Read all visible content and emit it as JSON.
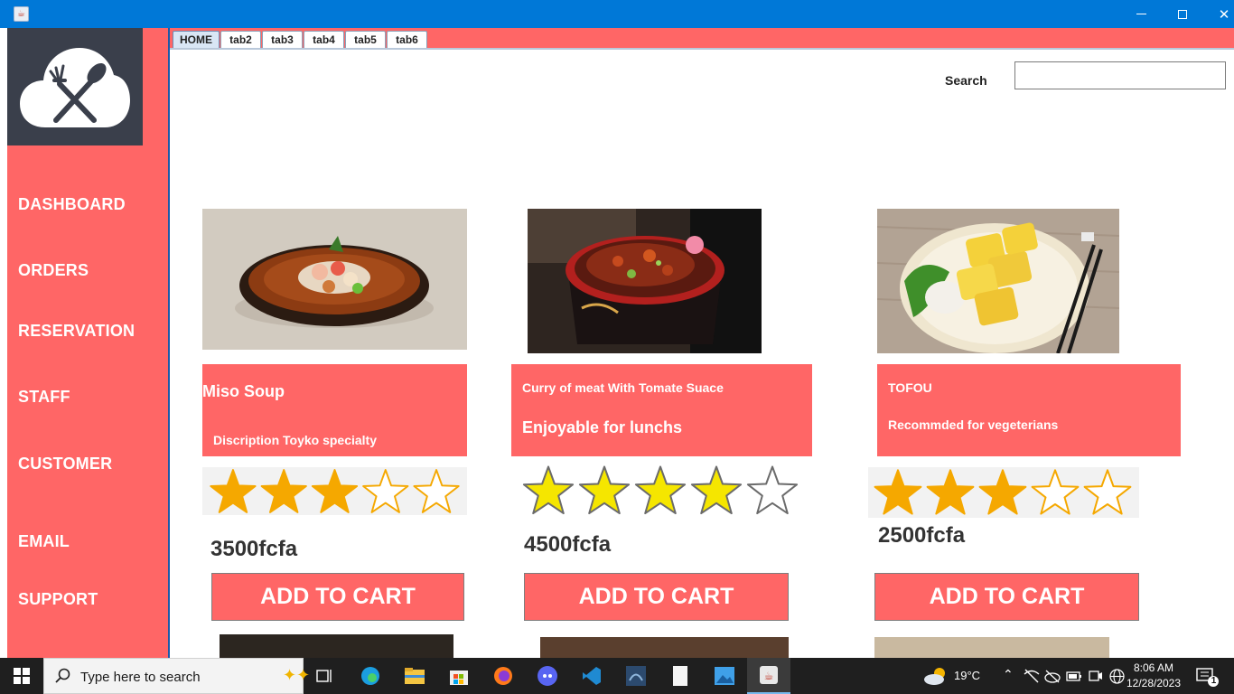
{
  "window": {
    "title": ""
  },
  "sidebar": {
    "items": [
      {
        "label": "DASHBOARD"
      },
      {
        "label": "ORDERS"
      },
      {
        "label": "RESERVATION"
      },
      {
        "label": "STAFF"
      },
      {
        "label": "CUSTOMER"
      },
      {
        "label": "EMAIL"
      },
      {
        "label": "SUPPORT"
      }
    ]
  },
  "tabs": [
    {
      "label": "HOME"
    },
    {
      "label": "tab2"
    },
    {
      "label": "tab3"
    },
    {
      "label": "tab4"
    },
    {
      "label": "tab5"
    },
    {
      "label": "tab6"
    }
  ],
  "search": {
    "label": "Search",
    "value": "",
    "placeholder": ""
  },
  "cards": [
    {
      "title": "Miso Soup",
      "description": "Discription Toyko specialty",
      "rating": 3,
      "max_rating": 5,
      "price": "3500fcfa",
      "button": "ADD TO CART"
    },
    {
      "title": "Curry of meat With Tomate Suace",
      "description": "Enjoyable for lunchs",
      "rating": 4,
      "max_rating": 5,
      "price": "4500fcfa",
      "button": "ADD TO CART"
    },
    {
      "title": "TOFOU",
      "description": "Recommded for vegeterians",
      "rating": 3,
      "max_rating": 5,
      "price": "2500fcfa",
      "button": "ADD TO CART"
    }
  ],
  "taskbar": {
    "search_placeholder": "Type here to search",
    "weather": "19°C",
    "time": "8:06 AM",
    "date": "12/28/2023",
    "notification_count": "1"
  },
  "colors": {
    "accent": "#ff6666",
    "titlebar": "#0078d7",
    "logo_bg": "#3a3f4b",
    "star_gold": "#f5a800",
    "star_yellow": "#f5e600"
  }
}
